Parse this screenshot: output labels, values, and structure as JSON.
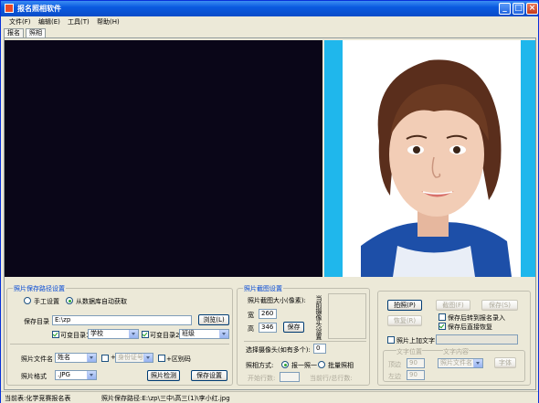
{
  "window": {
    "title": "报名照相软件",
    "min": "_",
    "max": "□",
    "close": "×"
  },
  "menu": [
    "文件(F)",
    "编辑(E)",
    "工具(T)",
    "帮助(H)"
  ],
  "tabs": [
    "报名",
    "照相"
  ],
  "save_path_group": {
    "label": "照片保存路径设置",
    "radio_manual": "手工设置",
    "radio_db": "从数据库自动获取",
    "dir_label": "保存目录",
    "dir_value": "E:\\zp",
    "browse": "浏览(L)",
    "var1_label": "可变目录1",
    "var1_value": "学校",
    "var2_label": "可变目录2",
    "var2_value": "班级",
    "filename_label": "照片文件名",
    "filename_value": "姓名",
    "plus": "+",
    "exam_no": "身份证号",
    "distinguish": "+区别码",
    "format_label": "照片格式",
    "format_value": ".JPG",
    "check_btn": "照片检测",
    "save_settings": "保存设置"
  },
  "crop_group": {
    "label": "照片截图设置",
    "size_label": "照片截图大小(像素):",
    "width_label": "宽",
    "width_value": "260",
    "height_label": "高",
    "height_value": "346",
    "save": "保存",
    "vertical_text": "当前摄像头设置",
    "camera_label": "选择摄像头(如有多个):",
    "camera_value": "0",
    "mode_label": "照相方式:",
    "mode_single": "报一照一",
    "mode_batch": "批量照相",
    "start_row": "开始行数:",
    "current_row": "当前行/总行数:"
  },
  "actions": {
    "shoot": "拍照(P)",
    "crop": "截图(F)",
    "save": "保存(S)",
    "restore": "恢复(R)",
    "auto_next": "保存后转到报名录入",
    "direct_restore": "保存后直接恢复",
    "add_text": "照片上加文字",
    "text_pos": "文字位置",
    "text_content": "文字内容",
    "top_label": "顶边",
    "left_label": "左边",
    "pos_top": "90",
    "pos_left": "90",
    "content_value": "照片文件名",
    "font_btn": "字体"
  },
  "status": {
    "current": "当前表:化学竞赛报名表",
    "path": "照片保存路径:E:\\zp\\三中\\高三(1)\\李小红.jpg"
  }
}
